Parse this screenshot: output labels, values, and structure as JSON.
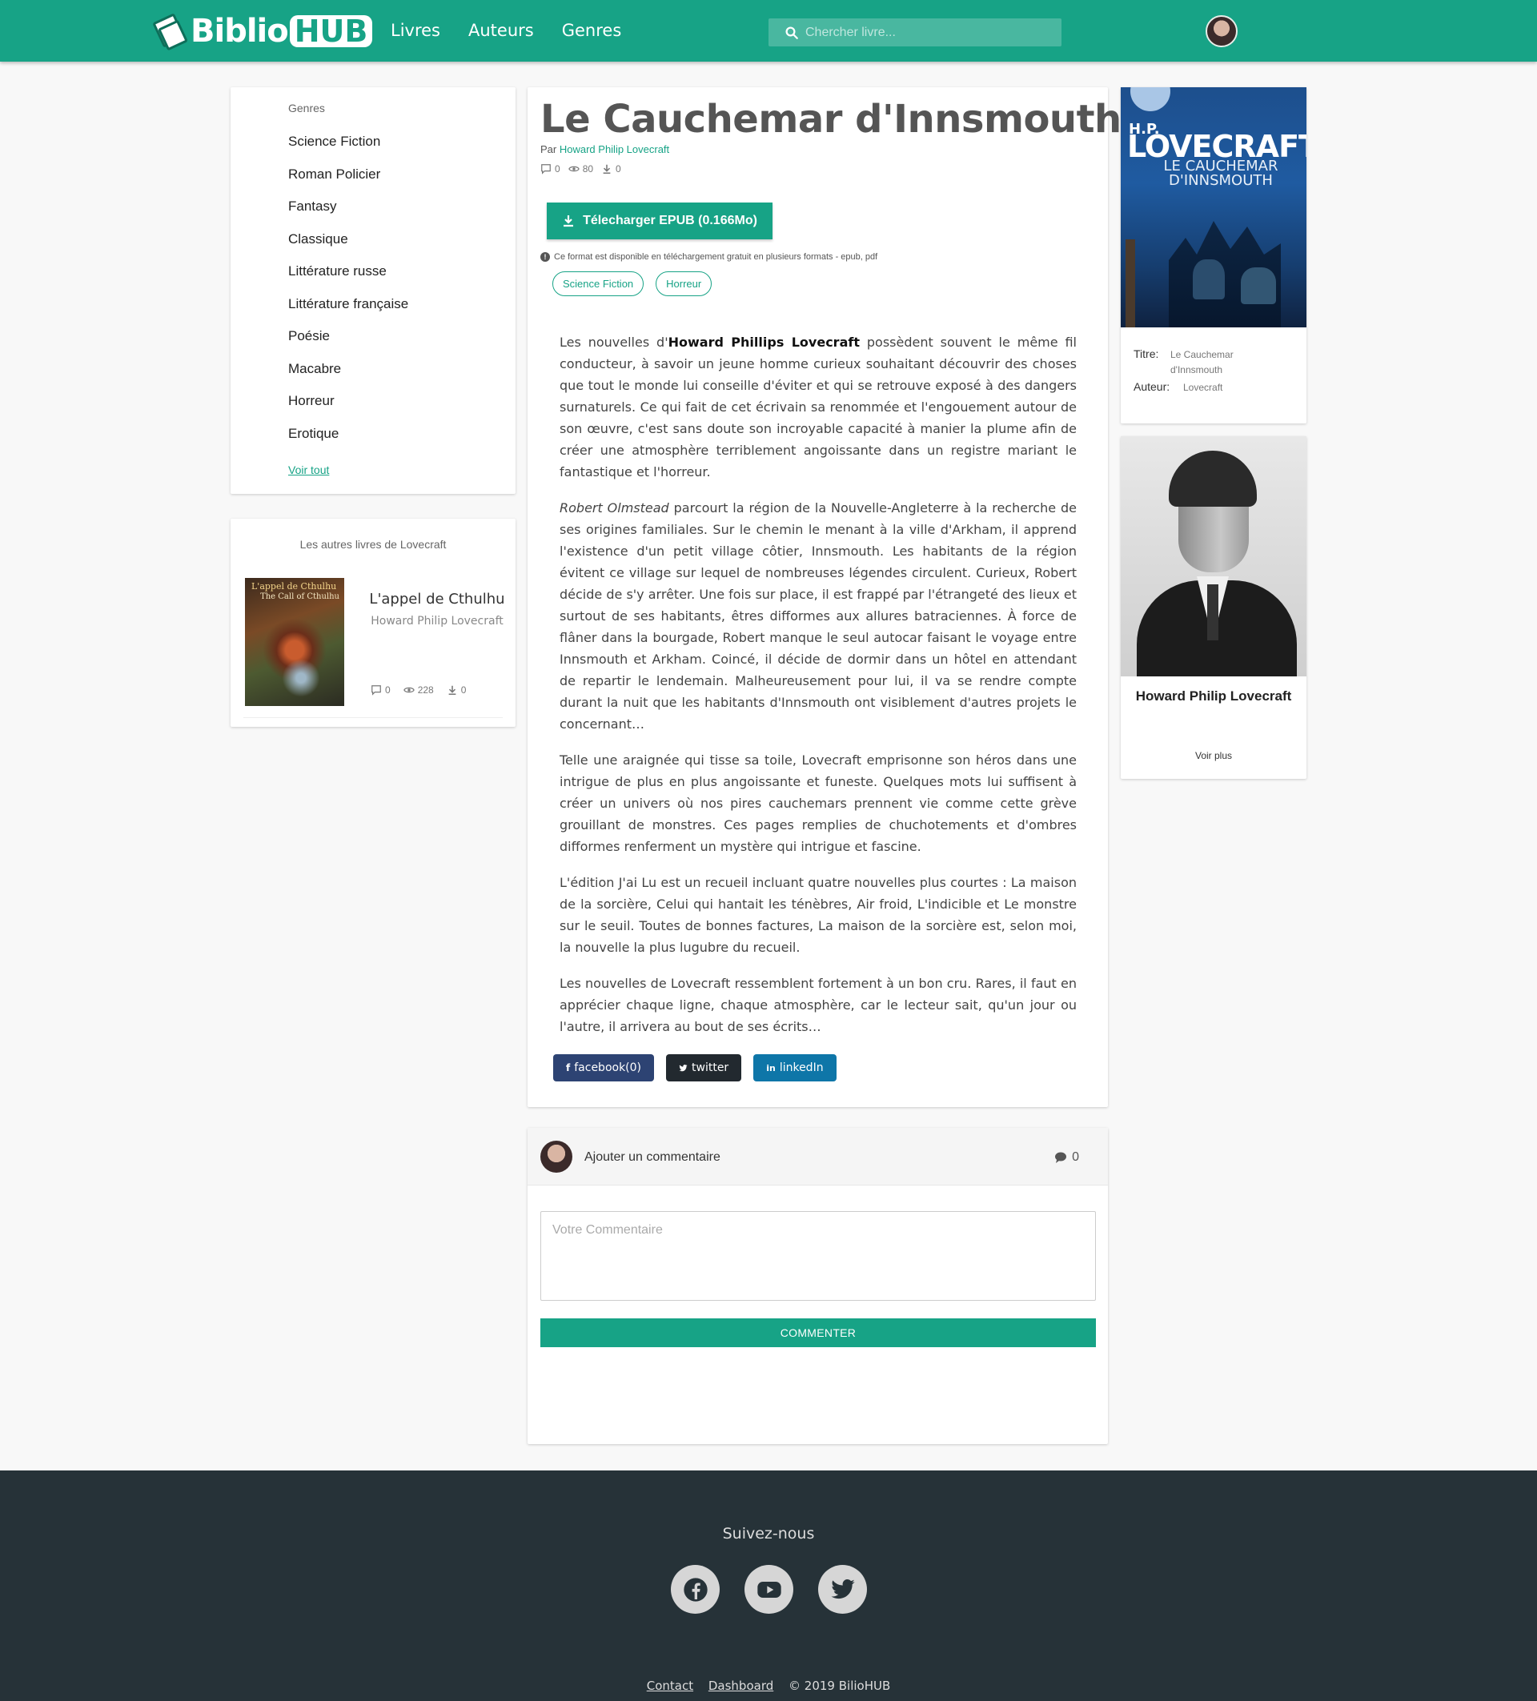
{
  "navbar": {
    "logo_biblio": "Biblio",
    "logo_hub": "HUB",
    "links": [
      "Livres",
      "Auteurs",
      "Genres"
    ],
    "search_placeholder": "Chercher livre...",
    "accent_color": "#17a386"
  },
  "genres": {
    "title": "Genres",
    "items": [
      "Science Fiction",
      "Roman Policier",
      "Fantasy",
      "Classique",
      "Littérature russe",
      "Littérature française",
      "Poésie",
      "Macabre",
      "Horreur",
      "Erotique"
    ],
    "see_all": "Voir tout"
  },
  "other_books": {
    "title": "Les autres livres de Lovecraft",
    "book": {
      "cover_title": "L'appel de Cthulhu",
      "cover_subtitle": "The Call of Cthulhu",
      "title": "L'appel de Cthulhu",
      "author": "Howard Philip Lovecraft",
      "comments": "0",
      "views": "228",
      "downloads": "0"
    }
  },
  "book": {
    "title": "Le Cauchemar d'Innsmouth",
    "by_prefix": "Par",
    "author": "Howard Philip Lovecraft",
    "comments": "0",
    "views": "80",
    "downloads": "0",
    "download_label": "Télecharger EPUB (0.166Mo)",
    "format_info": "Ce format est disponible en téléchargement gratuit en plusieurs formats - epub, pdf",
    "tags": [
      "Science Fiction",
      "Horreur"
    ],
    "description": {
      "p1_before": "Les nouvelles d'",
      "p1_bold": "Howard Phillips Lovecraft",
      "p1_after": " possèdent souvent le même fil conducteur, à savoir un jeune homme curieux souhaitant découvrir des choses que tout le monde lui conseille d'éviter et qui se retrouve exposé à des dangers surnaturels. Ce qui fait de cet écrivain sa renommée et l'engouement autour de son œuvre, c'est sans doute son incroyable capacité à manier la plume afin de créer une atmosphère terriblement angoissante dans un registre mariant le fantastique et l'horreur.",
      "p2_italic": "Robert Olmstead",
      "p2_after": " parcourt la région de la Nouvelle-Angleterre à la recherche de ses origines familiales. Sur le chemin le menant à la ville d'Arkham, il apprend l'existence d'un petit village côtier, Innsmouth. Les habitants de la région évitent ce village sur lequel de nombreuses légendes circulent. Curieux, Robert décide de s'y arrêter. Une fois sur place, il est frappé par l'étrangeté des lieux et surtout de ses habitants, êtres difformes aux allures batraciennes. À force de flâner dans la bourgade, Robert manque le seul autocar faisant le voyage entre Innsmouth et Arkham. Coincé, il décide de dormir dans un hôtel en attendant de repartir le lendemain. Malheureusement pour lui, il va se rendre compte durant la nuit que les habitants d'Innsmouth ont visiblement d'autres projets le concernant…",
      "p3": "Telle une araignée qui tisse sa toile, Lovecraft emprisonne son héros dans une intrigue de plus en plus angoissante et funeste. Quelques mots lui suffisent à créer un univers où nos pires cauchemars prennent vie comme cette grève grouillant de monstres. Ces pages remplies de chuchotements et d'ombres difformes renferment un mystère qui intrigue et fascine.",
      "p4": "L'édition J'ai Lu est un recueil incluant quatre nouvelles plus courtes : La maison de la sorcière, Celui qui hantait les ténèbres, Air froid, L'indicible et Le monstre sur le seuil. Toutes de bonnes factures, La maison de la sorcière est, selon moi, la nouvelle la plus lugubre du recueil.",
      "p5": "Les nouvelles de Lovecraft ressemblent fortement à un bon cru. Rares, il faut en apprécier chaque ligne, chaque atmosphère, car le lecteur sait, qu'un jour ou l'autre, il arrivera au bout de ses écrits…"
    },
    "share": {
      "facebook": "facebook(0)",
      "twitter": "twitter",
      "linkedin": "linkedIn"
    }
  },
  "comment_box": {
    "add_label": "Ajouter un commentaire",
    "count": "0",
    "placeholder": "Votre Commentaire",
    "submit": "COMMENTER"
  },
  "book_info": {
    "cover_hp": "H.P.",
    "cover_author": "LOVECRAFT",
    "cover_title": "LE CAUCHEMAR D'INNSMOUTH",
    "title_label": "Titre:",
    "title_value": "Le Cauchemar d'Innsmouth",
    "author_label": "Auteur:",
    "author_value": "Lovecraft"
  },
  "author_card": {
    "name": "Howard Philip Lovecraft",
    "more": "Voir plus"
  },
  "footer": {
    "follow": "Suivez-nous",
    "social": [
      "facebook-icon",
      "youtube-icon",
      "twitter-icon"
    ],
    "contact": "Contact",
    "dashboard": "Dashboard",
    "copyright": "© 2019 BilioHUB"
  }
}
